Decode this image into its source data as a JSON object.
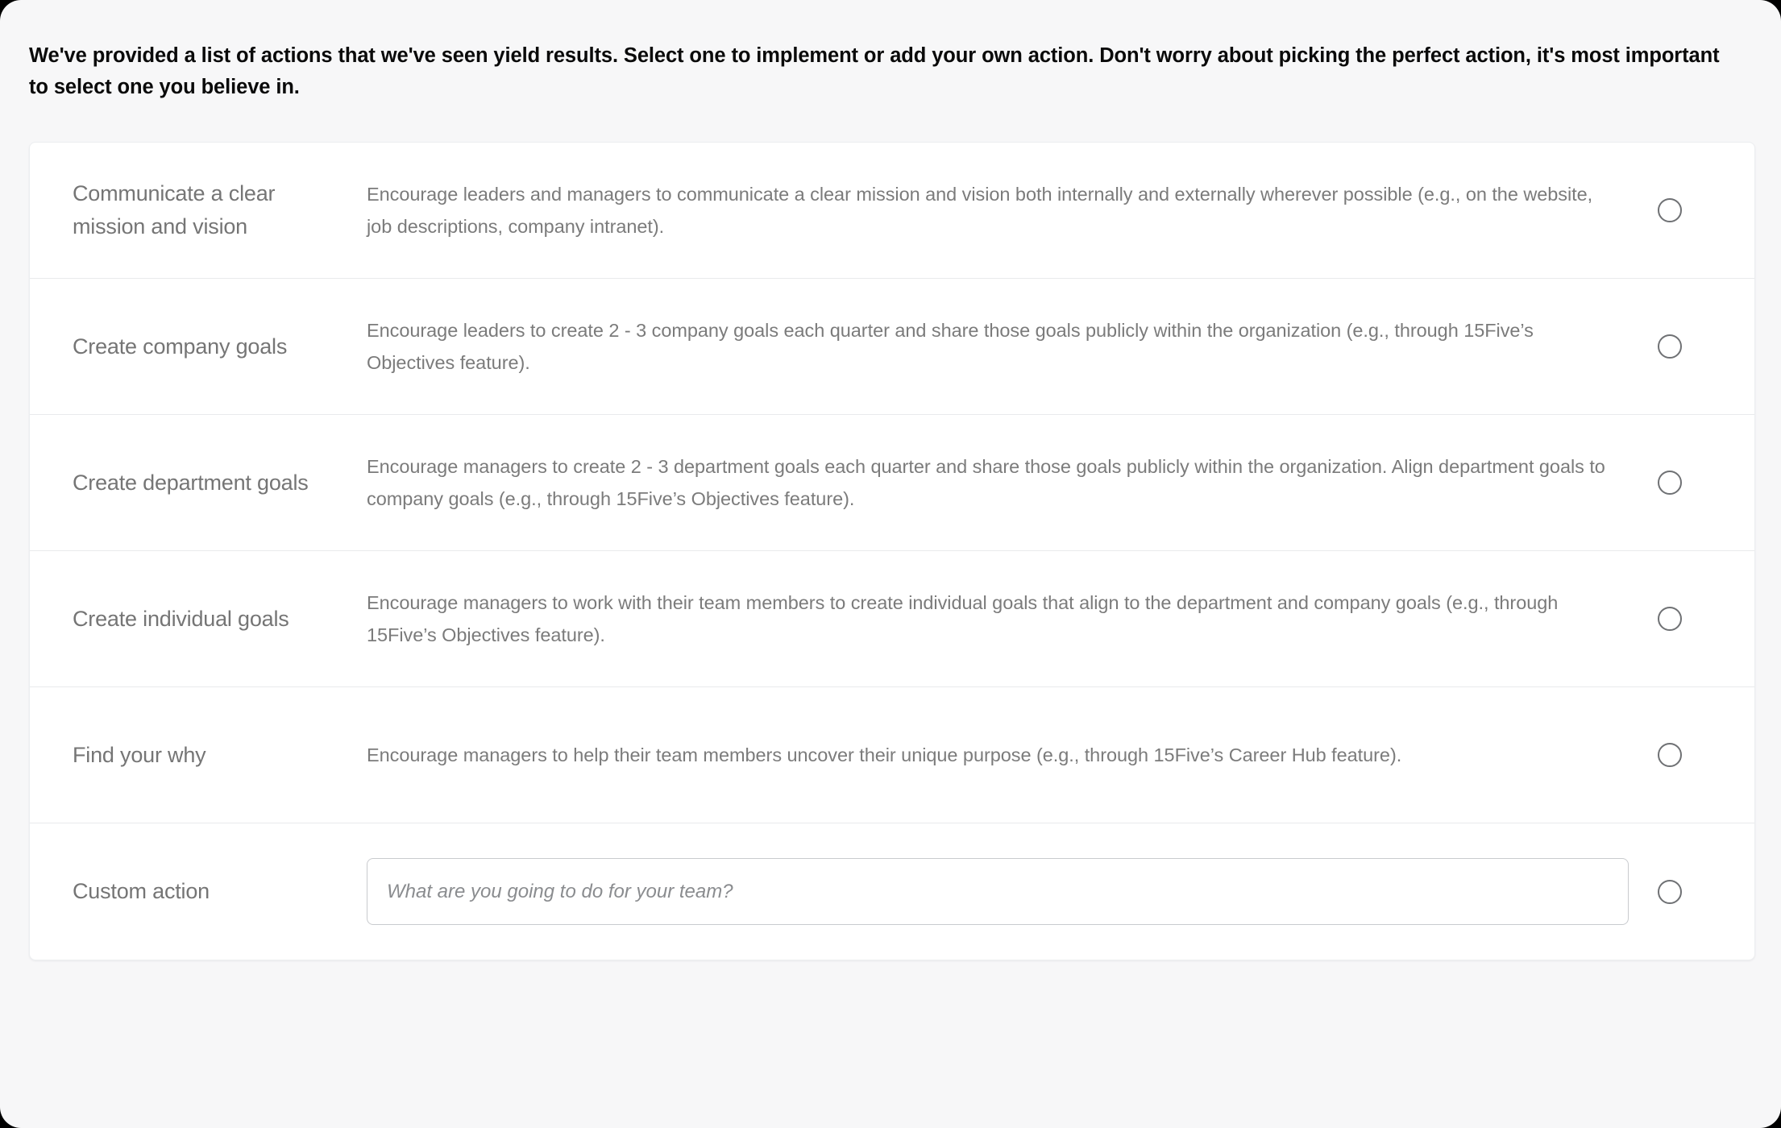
{
  "intro": {
    "text": "We've provided a list of actions that we've seen yield results. Select one to implement or add your own action. Don't worry about picking the perfect action, it's most important to select one you believe in."
  },
  "colors": {
    "page_background": "#f7f7f8",
    "card_background": "#ffffff",
    "row_divider": "#e9eaec",
    "title_text": "#757575",
    "description_text": "#7b7b7b",
    "intro_text": "#0a0a0a",
    "radio_border": "#6f7174",
    "input_border": "#c9cbce",
    "placeholder_text": "#8a8c8f"
  },
  "actions": [
    {
      "title": "Communicate a clear mission and vision",
      "description": "Encourage leaders and managers to communicate a clear mission and vision both internally and externally wherever possible (e.g., on the website, job descriptions, company intranet).",
      "radio_icon": "radio-unchecked-icon",
      "selected": false
    },
    {
      "title": "Create company goals",
      "description": "Encourage leaders to create 2 - 3 company goals each quarter and share those goals publicly within the organization (e.g., through 15Five’s Objectives feature).",
      "radio_icon": "radio-unchecked-icon",
      "selected": false
    },
    {
      "title": "Create department goals",
      "description": "Encourage managers to create 2 - 3 department goals each quarter and share those goals publicly within the organization. Align department goals to company goals (e.g., through 15Five’s Objectives feature).",
      "radio_icon": "radio-unchecked-icon",
      "selected": false
    },
    {
      "title": "Create individual goals",
      "description": "Encourage managers to work with their team members to create individual goals that align to the department and company goals (e.g., through 15Five’s Objectives feature).",
      "radio_icon": "radio-unchecked-icon",
      "selected": false
    },
    {
      "title": "Find your why",
      "description": "Encourage managers to help their team members uncover their unique purpose (e.g., through 15Five’s Career Hub feature).",
      "radio_icon": "radio-unchecked-icon",
      "selected": false
    }
  ],
  "custom_action": {
    "title": "Custom action",
    "input_value": "",
    "input_placeholder": "What are you going to do for your team?",
    "radio_icon": "radio-unchecked-icon",
    "selected": false
  }
}
